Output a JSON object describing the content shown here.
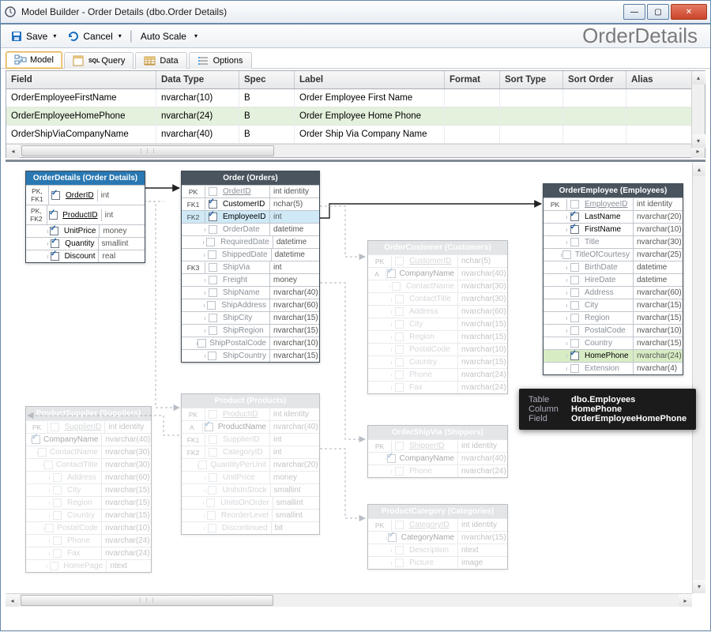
{
  "window": {
    "title": "Model Builder - Order Details (dbo.Order Details)"
  },
  "toolbar": {
    "save": "Save",
    "cancel": "Cancel",
    "autoscale": "Auto Scale"
  },
  "brand": "OrderDetails",
  "tabs": {
    "model": "Model",
    "query": "Query",
    "data": "Data",
    "options": "Options",
    "query_prefix": "SQL"
  },
  "grid": {
    "headers": {
      "field": "Field",
      "datatype": "Data Type",
      "spec": "Spec",
      "label": "Label",
      "format": "Format",
      "sorttype": "Sort Type",
      "sortorder": "Sort Order",
      "alias": "Alias"
    },
    "rows": [
      {
        "field": "OrderEmployeeFirstName",
        "dt": "nvarchar(10)",
        "spec": "B",
        "label": "Order Employee First Name"
      },
      {
        "field": "OrderEmployeeHomePhone",
        "dt": "nvarchar(24)",
        "spec": "B",
        "label": "Order Employee Home Phone",
        "hl": true
      },
      {
        "field": "OrderShipViaCompanyName",
        "dt": "nvarchar(40)",
        "spec": "B",
        "label": "Order Ship Via Company Name"
      }
    ]
  },
  "entities": {
    "orderdetails": {
      "title": "OrderDetails (Order Details)",
      "rows": [
        {
          "key": "PK, FK1",
          "chk": true,
          "name": "OrderID",
          "type": "int",
          "u": true
        },
        {
          "key": "PK, FK2",
          "chk": true,
          "name": "ProductID",
          "type": "int",
          "u": true
        },
        {
          "key": "",
          "chk": true,
          "name": "UnitPrice",
          "type": "money"
        },
        {
          "key": "",
          "chk": true,
          "name": "Quantity",
          "type": "smallint"
        },
        {
          "key": "",
          "chk": true,
          "name": "Discount",
          "type": "real"
        }
      ]
    },
    "order": {
      "title": "Order (Orders)",
      "rows": [
        {
          "key": "PK",
          "chk": false,
          "name": "OrderID",
          "type": "int identity",
          "u": true,
          "dim": true
        },
        {
          "key": "FK1",
          "chk": true,
          "name": "CustomerID",
          "type": "nchar(5)"
        },
        {
          "key": "FK2",
          "chk": true,
          "name": "EmployeeID",
          "type": "int",
          "sel": true
        },
        {
          "key": "",
          "chk": false,
          "name": "OrderDate",
          "type": "datetime",
          "dim": true
        },
        {
          "key": "",
          "chk": false,
          "name": "RequiredDate",
          "type": "datetime",
          "dim": true
        },
        {
          "key": "",
          "chk": false,
          "name": "ShippedDate",
          "type": "datetime",
          "dim": true
        },
        {
          "key": "FK3",
          "chk": false,
          "name": "ShipVia",
          "type": "int",
          "dim": true
        },
        {
          "key": "",
          "chk": false,
          "name": "Freight",
          "type": "money",
          "dim": true
        },
        {
          "key": "",
          "chk": false,
          "name": "ShipName",
          "type": "nvarchar(40)",
          "dim": true
        },
        {
          "key": "",
          "chk": false,
          "name": "ShipAddress",
          "type": "nvarchar(60)",
          "dim": true
        },
        {
          "key": "",
          "chk": false,
          "name": "ShipCity",
          "type": "nvarchar(15)",
          "dim": true
        },
        {
          "key": "",
          "chk": false,
          "name": "ShipRegion",
          "type": "nvarchar(15)",
          "dim": true
        },
        {
          "key": "",
          "chk": false,
          "name": "ShipPostalCode",
          "type": "nvarchar(10)",
          "dim": true
        },
        {
          "key": "",
          "chk": false,
          "name": "ShipCountry",
          "type": "nvarchar(15)",
          "dim": true
        }
      ]
    },
    "ordercustomer": {
      "title": "OrderCustomer (Customers)",
      "rows": [
        {
          "key": "PK",
          "chk": false,
          "name": "CustomerID",
          "type": "nchar(5)",
          "u": true,
          "dim": true
        },
        {
          "key": "A",
          "chk": true,
          "name": "CompanyName",
          "type": "nvarchar(40)"
        },
        {
          "key": "",
          "chk": false,
          "name": "ContactName",
          "type": "nvarchar(30)",
          "dim": true
        },
        {
          "key": "",
          "chk": false,
          "name": "ContactTitle",
          "type": "nvarchar(30)",
          "dim": true
        },
        {
          "key": "",
          "chk": false,
          "name": "Address",
          "type": "nvarchar(60)",
          "dim": true
        },
        {
          "key": "",
          "chk": false,
          "name": "City",
          "type": "nvarchar(15)",
          "dim": true
        },
        {
          "key": "",
          "chk": false,
          "name": "Region",
          "type": "nvarchar(15)",
          "dim": true
        },
        {
          "key": "",
          "chk": false,
          "name": "PostalCode",
          "type": "nvarchar(10)",
          "dim": true
        },
        {
          "key": "",
          "chk": false,
          "name": "Country",
          "type": "nvarchar(15)",
          "dim": true
        },
        {
          "key": "",
          "chk": false,
          "name": "Phone",
          "type": "nvarchar(24)",
          "dim": true
        },
        {
          "key": "",
          "chk": false,
          "name": "Fax",
          "type": "nvarchar(24)",
          "dim": true
        }
      ]
    },
    "orderemployee": {
      "title": "OrderEmployee (Employees)",
      "rows": [
        {
          "key": "PK",
          "chk": false,
          "name": "EmployeeID",
          "type": "int identity",
          "u": true,
          "dim": true
        },
        {
          "key": "",
          "chk": true,
          "name": "LastName",
          "type": "nvarchar(20)"
        },
        {
          "key": "",
          "chk": true,
          "name": "FirstName",
          "type": "nvarchar(10)"
        },
        {
          "key": "",
          "chk": false,
          "name": "Title",
          "type": "nvarchar(30)",
          "dim": true
        },
        {
          "key": "",
          "chk": false,
          "name": "TitleOfCourtesy",
          "type": "nvarchar(25)",
          "dim": true
        },
        {
          "key": "",
          "chk": false,
          "name": "BirthDate",
          "type": "datetime",
          "dim": true
        },
        {
          "key": "",
          "chk": false,
          "name": "HireDate",
          "type": "datetime",
          "dim": true
        },
        {
          "key": "",
          "chk": false,
          "name": "Address",
          "type": "nvarchar(60)",
          "dim": true
        },
        {
          "key": "",
          "chk": false,
          "name": "City",
          "type": "nvarchar(15)",
          "dim": true
        },
        {
          "key": "",
          "chk": false,
          "name": "Region",
          "type": "nvarchar(15)",
          "dim": true
        },
        {
          "key": "",
          "chk": false,
          "name": "PostalCode",
          "type": "nvarchar(10)",
          "dim": true
        },
        {
          "key": "",
          "chk": false,
          "name": "Country",
          "type": "nvarchar(15)",
          "dim": true
        },
        {
          "key": "",
          "chk": true,
          "name": "HomePhone",
          "type": "nvarchar(24)",
          "hl": true
        },
        {
          "key": "",
          "chk": false,
          "name": "Extension",
          "type": "nvarchar(4)",
          "dim": true
        }
      ]
    },
    "product": {
      "title": "Product (Products)",
      "rows": [
        {
          "key": "PK",
          "chk": false,
          "name": "ProductID",
          "type": "int identity",
          "u": true,
          "dim": true
        },
        {
          "key": "A",
          "chk": true,
          "name": "ProductName",
          "type": "nvarchar(40)"
        },
        {
          "key": "FK1",
          "chk": false,
          "name": "SupplierID",
          "type": "int",
          "dim": true
        },
        {
          "key": "FK2",
          "chk": false,
          "name": "CategoryID",
          "type": "int",
          "dim": true
        },
        {
          "key": "",
          "chk": false,
          "name": "QuantityPerUnit",
          "type": "nvarchar(20)",
          "dim": true
        },
        {
          "key": "",
          "chk": false,
          "name": "UnitPrice",
          "type": "money",
          "dim": true
        },
        {
          "key": "",
          "chk": false,
          "name": "UnitsInStock",
          "type": "smallint",
          "dim": true
        },
        {
          "key": "",
          "chk": false,
          "name": "UnitsOnOrder",
          "type": "smallint",
          "dim": true
        },
        {
          "key": "",
          "chk": false,
          "name": "ReorderLevel",
          "type": "smallint",
          "dim": true
        },
        {
          "key": "",
          "chk": false,
          "name": "Discontinued",
          "type": "bit",
          "dim": true
        }
      ]
    },
    "productsupplier": {
      "title": "ProductSupplier (Suppliers)",
      "rows": [
        {
          "key": "PK",
          "chk": false,
          "name": "SupplierID",
          "type": "int identity",
          "u": true,
          "dim": true
        },
        {
          "key": "",
          "chk": true,
          "name": "CompanyName",
          "type": "nvarchar(40)"
        },
        {
          "key": "",
          "chk": false,
          "name": "ContactName",
          "type": "nvarchar(30)",
          "dim": true
        },
        {
          "key": "",
          "chk": false,
          "name": "ContactTitle",
          "type": "nvarchar(30)",
          "dim": true
        },
        {
          "key": "",
          "chk": false,
          "name": "Address",
          "type": "nvarchar(60)",
          "dim": true
        },
        {
          "key": "",
          "chk": false,
          "name": "City",
          "type": "nvarchar(15)",
          "dim": true
        },
        {
          "key": "",
          "chk": false,
          "name": "Region",
          "type": "nvarchar(15)",
          "dim": true
        },
        {
          "key": "",
          "chk": false,
          "name": "Country",
          "type": "nvarchar(15)",
          "dim": true
        },
        {
          "key": "",
          "chk": false,
          "name": "PostalCode",
          "type": "nvarchar(10)",
          "dim": true
        },
        {
          "key": "",
          "chk": false,
          "name": "Phone",
          "type": "nvarchar(24)",
          "dim": true
        },
        {
          "key": "",
          "chk": false,
          "name": "Fax",
          "type": "nvarchar(24)",
          "dim": true
        },
        {
          "key": "",
          "chk": false,
          "name": "HomePage",
          "type": "ntext",
          "dim": true
        }
      ]
    },
    "ordershipvia": {
      "title": "OrderShipVia (Shippers)",
      "rows": [
        {
          "key": "PK",
          "chk": false,
          "name": "ShipperID",
          "type": "int identity",
          "u": true,
          "dim": true
        },
        {
          "key": "",
          "chk": true,
          "name": "CompanyName",
          "type": "nvarchar(40)"
        },
        {
          "key": "",
          "chk": false,
          "name": "Phone",
          "type": "nvarchar(24)",
          "dim": true
        }
      ]
    },
    "productcategory": {
      "title": "ProductCategory (Categories)",
      "rows": [
        {
          "key": "PK",
          "chk": false,
          "name": "CategoryID",
          "type": "int identity",
          "u": true,
          "dim": true
        },
        {
          "key": "",
          "chk": true,
          "name": "CategoryName",
          "type": "nvarchar(15)"
        },
        {
          "key": "",
          "chk": false,
          "name": "Description",
          "type": "ntext",
          "dim": true
        },
        {
          "key": "",
          "chk": false,
          "name": "Picture",
          "type": "image",
          "dim": true
        }
      ]
    }
  },
  "tooltip": {
    "table_lbl": "Table",
    "table_val": "dbo.Employees",
    "column_lbl": "Column",
    "column_val": "HomePhone",
    "field_lbl": "Field",
    "field_val": "OrderEmployeeHomePhone"
  }
}
